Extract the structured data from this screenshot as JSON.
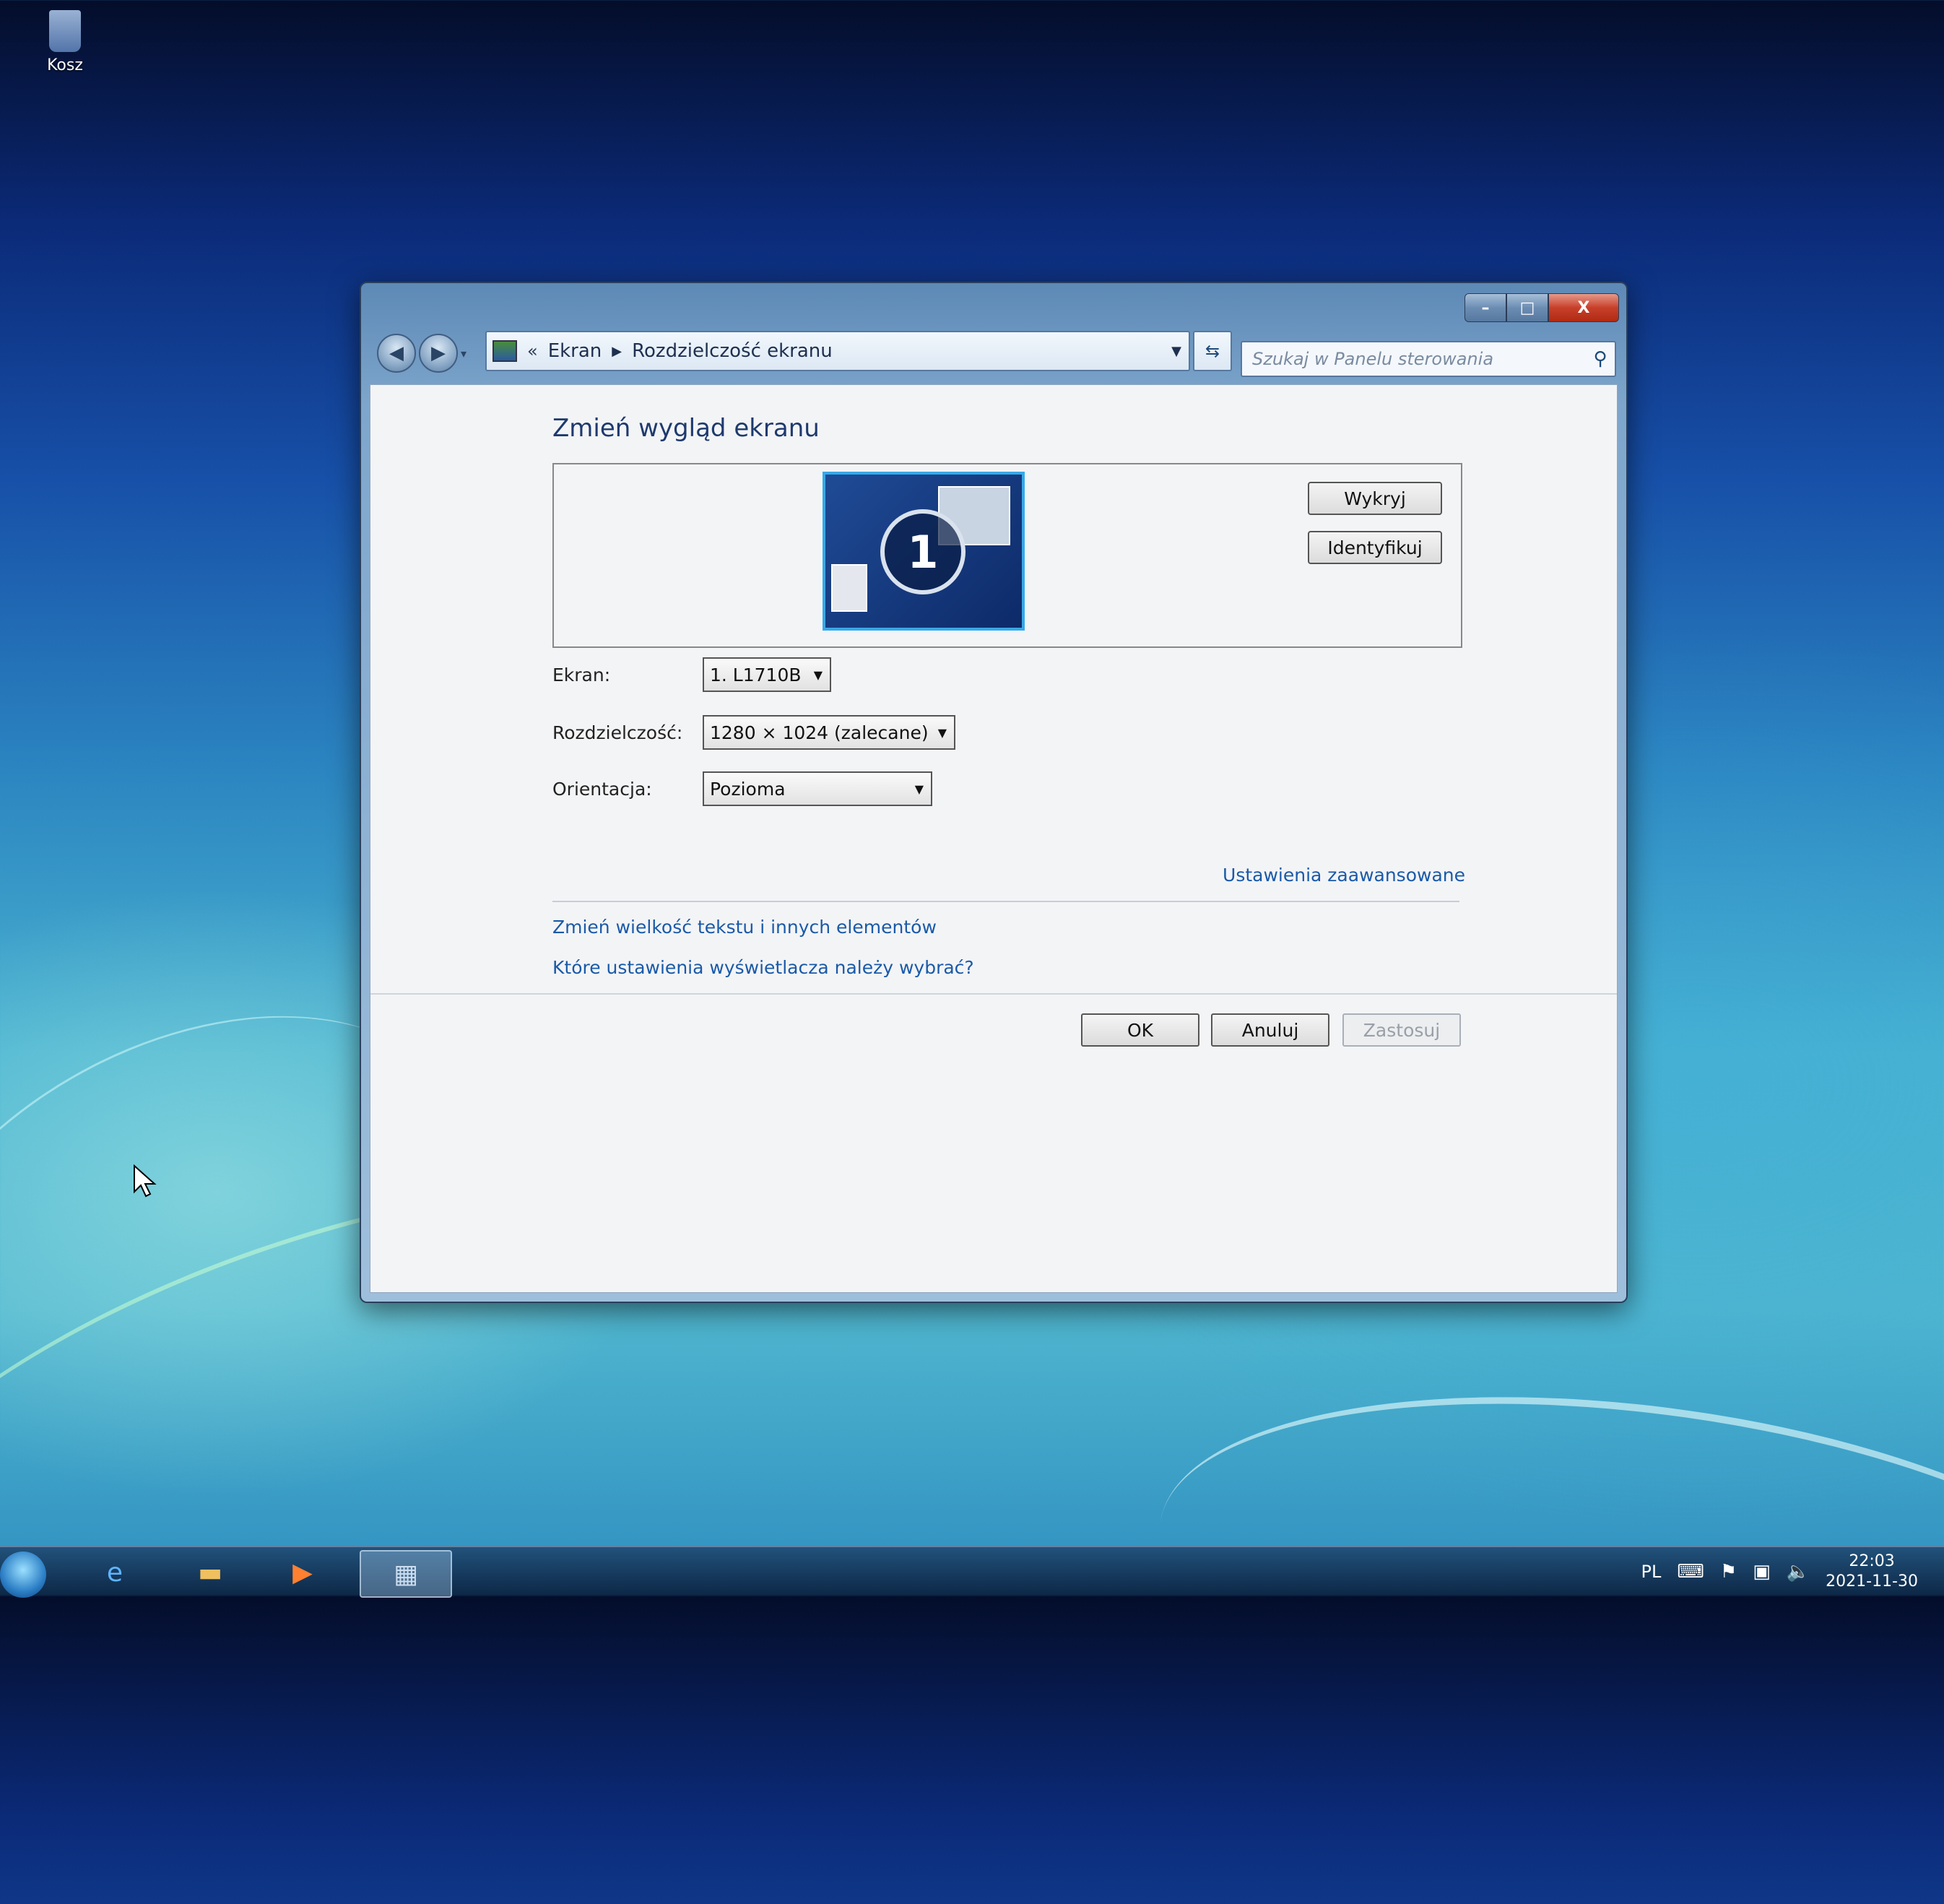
{
  "desktop": {
    "recycle_bin_label": "Kosz"
  },
  "window": {
    "controls": {
      "minimize": "–",
      "maximize": "□",
      "close": "X"
    },
    "nav": {
      "back": "◀",
      "forward": "▶"
    },
    "breadcrumb": {
      "prefix": "«",
      "items": [
        "Ekran",
        "Rozdzielczość ekranu"
      ]
    },
    "search_placeholder": "Szukaj w Panelu sterowania",
    "page_title": "Zmień wygląd ekranu",
    "monitor_number": "1",
    "detect_button": "Wykryj",
    "identify_button": "Identyfikuj",
    "fields": {
      "display_label": "Ekran:",
      "display_value": "1. L1710B",
      "resolution_label": "Rozdzielczość:",
      "resolution_value": "1280 × 1024 (zalecane)",
      "orientation_label": "Orientacja:",
      "orientation_value": "Pozioma"
    },
    "advanced_link": "Ustawienia zaawansowane",
    "links": [
      "Zmień wielkość tekstu i innych elementów",
      "Które ustawienia wyświetlacza należy wybrać?"
    ],
    "buttons": {
      "ok": "OK",
      "cancel": "Anuluj",
      "apply": "Zastosuj"
    }
  },
  "taskbar": {
    "language": "PL",
    "time": "22:03",
    "date": "2021-11-30"
  }
}
